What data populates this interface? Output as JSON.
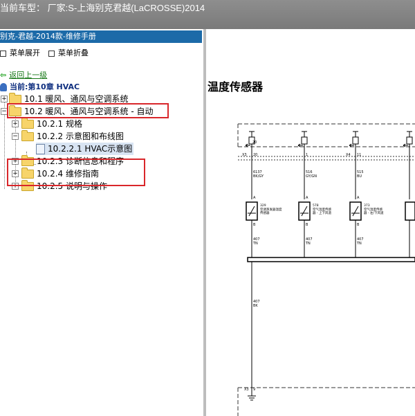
{
  "titlebar": {
    "text": "当前车型： 厂家:S-上海别克君越(LaCROSSE)2014"
  },
  "left_header": {
    "text": "别克-君越-2014款-维修手册"
  },
  "menu": {
    "expand_label": "菜单展开",
    "collapse_label": "菜单折叠"
  },
  "nav": {
    "back_label": "返回上一级",
    "current_label": "当前:第10章 HVAC"
  },
  "tree": [
    {
      "label": "10.1 暖风、通风与空调系统"
    },
    {
      "label": "10.2 暖风、通风与空调系统 - 自动"
    },
    {
      "label": "10.2.1 规格"
    },
    {
      "label": "10.2.2 示意图和布线图"
    },
    {
      "label": "10.2.2.1 HVAC示意图"
    },
    {
      "label": "10.2.3 诊断信息和程序"
    },
    {
      "label": "10.2.4 维修指南"
    },
    {
      "label": "10.2.5 说明与操作"
    }
  ],
  "document": {
    "title": "温度传感器",
    "schematic": {
      "fuse_labels": [
        "20",
        "1",
        "11"
      ],
      "connector_labels": [
        "X3",
        "X4"
      ],
      "wires_top": [
        {
          "circuit": "6137",
          "color": "BK/GY"
        },
        {
          "circuit": "516",
          "color": "GY/GN"
        },
        {
          "circuit": "515",
          "color": "BU"
        }
      ],
      "pin_top": "A",
      "pin_bottom": "B",
      "sensors": [
        {
          "id": "329",
          "name": "空调蒸发器温度传感器"
        },
        {
          "id": "578",
          "name": "空气温度传感器 - 上下风道"
        },
        {
          "id": "373",
          "name": "空气温度传感器 - 左/下风道"
        }
      ],
      "wires_bottom": {
        "circuit": "407",
        "color": "TN"
      },
      "ground_wire": {
        "circuit": "407",
        "color": "BK"
      },
      "ground_connector": {
        "label": "X3",
        "pin": "9"
      }
    }
  }
}
